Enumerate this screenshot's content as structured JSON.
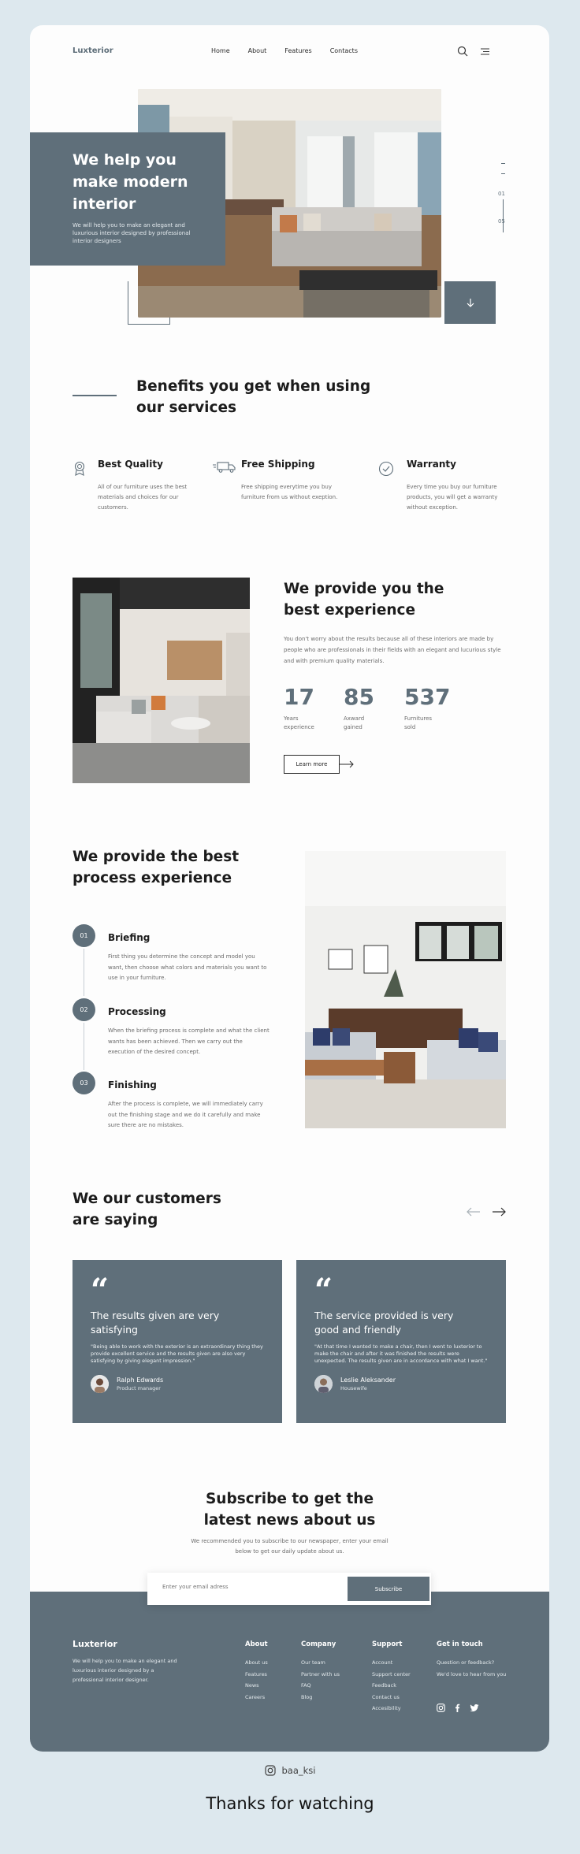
{
  "nav": {
    "logo": "Luxterior",
    "links": [
      "Home",
      "About",
      "Features",
      "Contacts"
    ]
  },
  "hero": {
    "title": "We help you make modern interior",
    "subtitle": "We will help you to make an elegant and luxurious interior designed by professional interior designers",
    "slide_current": "01",
    "slide_total": "05"
  },
  "benefits": {
    "title": "Benefits you get when using our services",
    "items": [
      {
        "name": "Best Quality",
        "desc": "All of our furniture uses the best materials and choices for our customers.",
        "icon": "award-icon"
      },
      {
        "name": "Free Shipping",
        "desc": "Free shipping everytime you buy furniture from us without exeption.",
        "icon": "truck-icon"
      },
      {
        "name": "Warranty",
        "desc": "Every time you buy our furniture products, you will get a warranty without exception.",
        "icon": "check-circle-icon"
      }
    ]
  },
  "experience": {
    "title": "We provide you the best experience",
    "desc": "You don't worry about the results because all of these interiors are made by people who are professionals in their fields with an elegant and lucurious style and with premium quality materials.",
    "stats": [
      {
        "num": "17",
        "label": "Years experience"
      },
      {
        "num": "85",
        "label": "Axward gained"
      },
      {
        "num": "537",
        "label": "Furnitures sold"
      }
    ],
    "cta": "Learn more"
  },
  "process": {
    "title": "We provide  the best process experience",
    "steps": [
      {
        "num": "01",
        "title": "Briefing",
        "desc": "First thing you determine the concept and model you want, then choose what colors and materials you want to use in your furniture."
      },
      {
        "num": "02",
        "title": "Processing",
        "desc": "When the briefing process is complete and what the client wants has been achieved. Then we carry out the execution of the desired concept."
      },
      {
        "num": "03",
        "title": "Finishing",
        "desc": "After the process is complete, we will immediately carry out the finishing stage and we do it carefully and make sure there are no mistakes."
      }
    ]
  },
  "testimonials": {
    "title": "We our customers are saying",
    "quote_mark": "“",
    "items": [
      {
        "headline": "The results given are very satisfying",
        "body": "\"Being able to work with the exterior is an extraordinary thing they provide excellent service and the results given are also very satisfying by giving elegant impression.\"",
        "name": "Ralph Edwards",
        "role": "Product manager"
      },
      {
        "headline": "The service provided is very good and friendly",
        "body": "\"At that time I wanted to make a chair, then I went to luxterior to make the chair and after it was finished the results were unexpected. The results given are in accordance with what I want.\"",
        "name": "Leslie Aleksander",
        "role": "Housewife"
      }
    ]
  },
  "subscribe": {
    "title": "Subscribe to get the latest news about us",
    "desc": "We recommended you to subscribe to our newspaper, enter your email below to get our daily update about us.",
    "placeholder": "Enter your email adress",
    "button": "Subscribe"
  },
  "footer": {
    "logo": "Luxterior",
    "desc": "We will help you to make an elegant and luxurious interior designed by a professional interior designer.",
    "columns": [
      {
        "head": "About",
        "items": [
          "About us",
          "Features",
          "News",
          "Careers"
        ]
      },
      {
        "head": "Company",
        "items": [
          "Our team",
          "Partner with us",
          "FAQ",
          "Blog"
        ]
      },
      {
        "head": "Support",
        "items": [
          "Account",
          "Support center",
          "Feedback",
          "Contact us",
          "Accesibility"
        ]
      },
      {
        "head": "Get in touch",
        "items": [
          "Question or feedback?",
          "We'd love to hear from you"
        ]
      }
    ]
  },
  "credit": {
    "handle": "baa_ksi",
    "thanks": "Thanks  for watching"
  },
  "colors": {
    "accent": "#5f6f7a",
    "background": "#dde8ee"
  }
}
